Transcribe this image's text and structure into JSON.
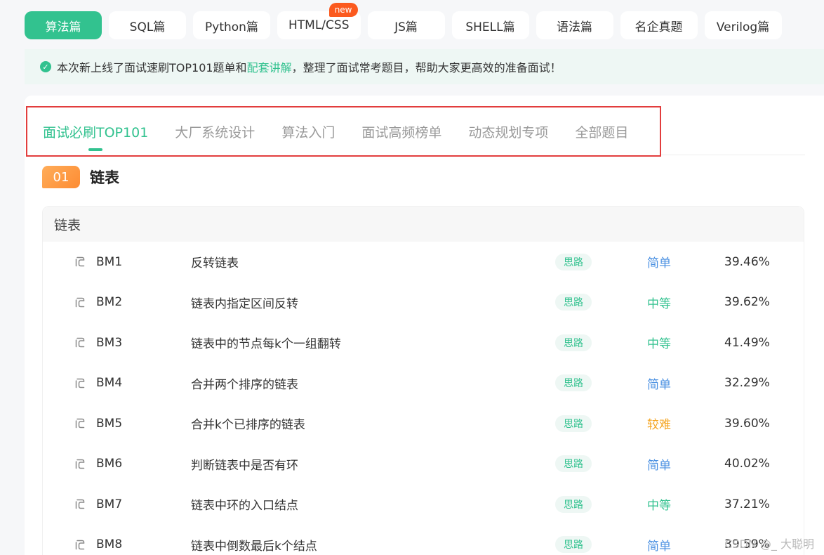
{
  "categories": [
    {
      "label": "算法篇",
      "active": true
    },
    {
      "label": "SQL篇",
      "active": false
    },
    {
      "label": "Python篇",
      "active": false
    },
    {
      "label": "HTML/CSS",
      "active": false,
      "badge": "new"
    },
    {
      "label": "JS篇",
      "active": false
    },
    {
      "label": "SHELL篇",
      "active": false
    },
    {
      "label": "语法篇",
      "active": false
    },
    {
      "label": "名企真题",
      "active": false
    },
    {
      "label": "Verilog篇",
      "active": false
    }
  ],
  "notice": {
    "prefix": "本次新上线了面试速刷TOP101题单和",
    "link": "配套讲解",
    "suffix": "，整理了面试常考题目，帮助大家更高效的准备面试！"
  },
  "tabs": [
    {
      "label": "面试必刷TOP101",
      "active": true
    },
    {
      "label": "大厂系统设计",
      "active": false
    },
    {
      "label": "算法入门",
      "active": false
    },
    {
      "label": "面试高频榜单",
      "active": false
    },
    {
      "label": "动态规划专项",
      "active": false
    },
    {
      "label": "全部题目",
      "active": false
    }
  ],
  "section": {
    "number": "01",
    "title": "链表"
  },
  "table": {
    "header": "链表",
    "hint_label": "思路",
    "rows": [
      {
        "id": "BM1",
        "name": "反转链表",
        "difficulty": "简单",
        "level": "easy",
        "rate": "39.46%"
      },
      {
        "id": "BM2",
        "name": "链表内指定区间反转",
        "difficulty": "中等",
        "level": "medium",
        "rate": "39.62%"
      },
      {
        "id": "BM3",
        "name": "链表中的节点每k个一组翻转",
        "difficulty": "中等",
        "level": "medium",
        "rate": "41.49%"
      },
      {
        "id": "BM4",
        "name": "合并两个排序的链表",
        "difficulty": "简单",
        "level": "easy",
        "rate": "32.29%"
      },
      {
        "id": "BM5",
        "name": "合并k个已排序的链表",
        "difficulty": "较难",
        "level": "hard",
        "rate": "39.60%"
      },
      {
        "id": "BM6",
        "name": "判断链表中是否有环",
        "difficulty": "简单",
        "level": "easy",
        "rate": "40.02%"
      },
      {
        "id": "BM7",
        "name": "链表中环的入口结点",
        "difficulty": "中等",
        "level": "medium",
        "rate": "37.21%"
      },
      {
        "id": "BM8",
        "name": "链表中倒数最后k个结点",
        "difficulty": "简单",
        "level": "easy",
        "rate": "39.59%"
      }
    ]
  },
  "watermark": "CSDN @_ 大聪明",
  "colors": {
    "accent": "#32c28f",
    "easy": "#4a90e2",
    "medium": "#32c28f",
    "hard": "#f5a623",
    "highlight_border": "#e23d3d"
  }
}
